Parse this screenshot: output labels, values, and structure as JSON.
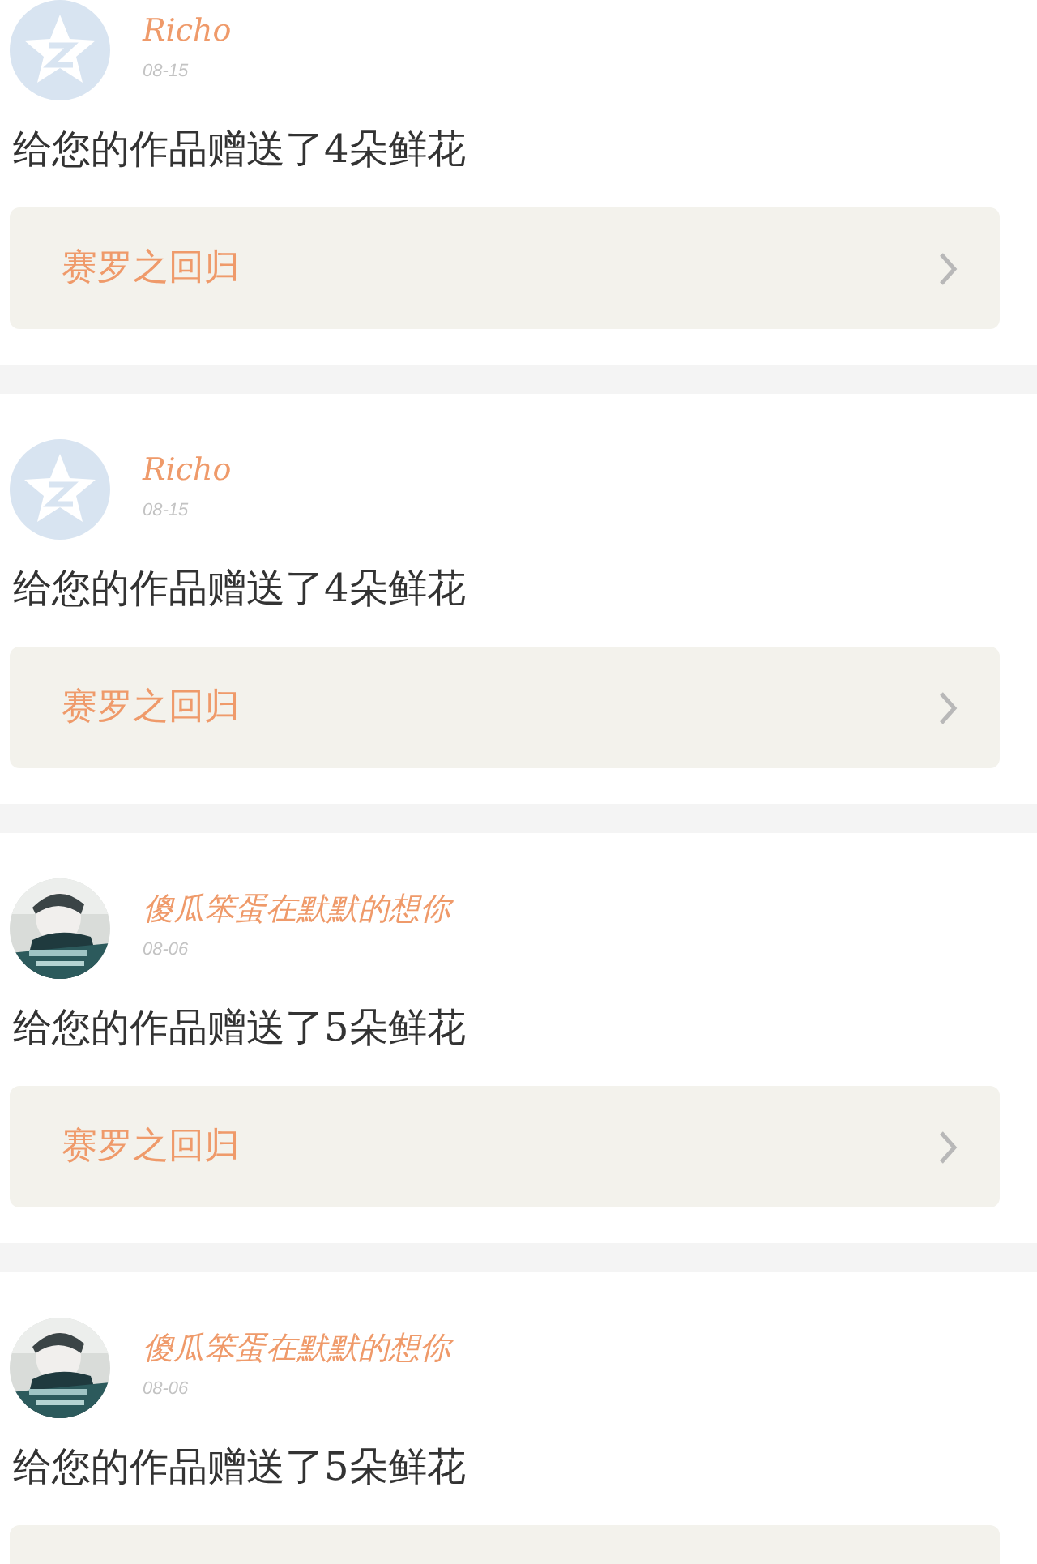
{
  "items": [
    {
      "avatar": {
        "kind": "star"
      },
      "name": "Richo",
      "date": "08-15",
      "message": "给您的作品赠送了4朵鲜花",
      "work": "赛罗之回归"
    },
    {
      "avatar": {
        "kind": "star"
      },
      "name": "Richo",
      "date": "08-15",
      "message": "给您的作品赠送了4朵鲜花",
      "work": "赛罗之回归"
    },
    {
      "name": "傻瓜笨蛋在默默的想你",
      "date": "08-06",
      "message": "给您的作品赠送了5朵鲜花",
      "work": "赛罗之回归"
    },
    {
      "name": "傻瓜笨蛋在默默的想你",
      "date": "08-06",
      "message": "给您的作品赠送了5朵鲜花"
    }
  ]
}
